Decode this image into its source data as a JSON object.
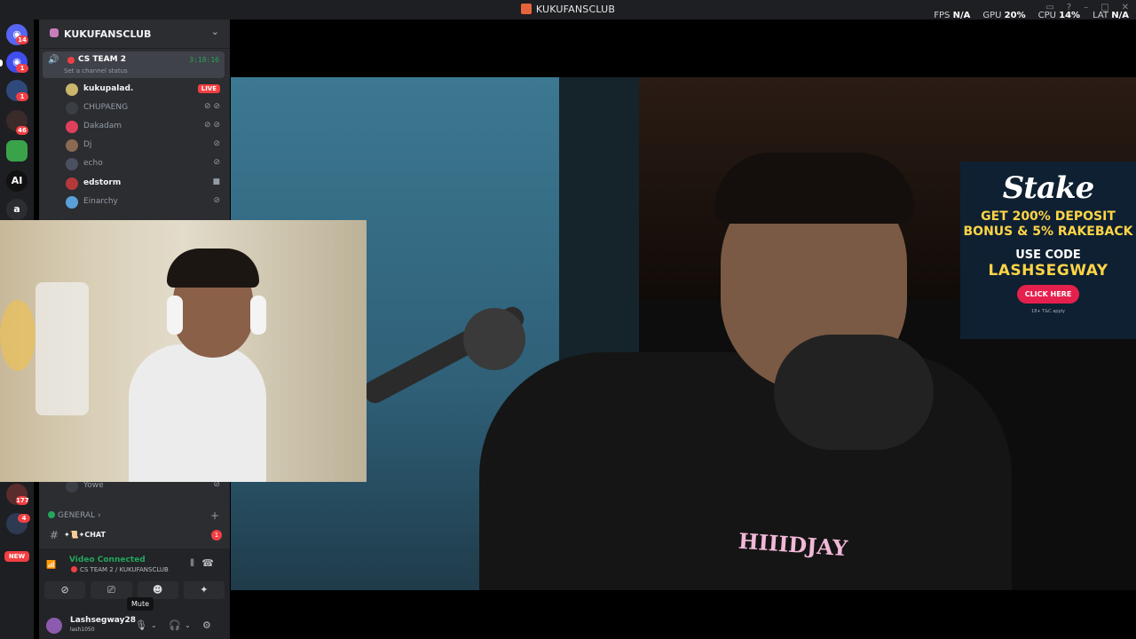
{
  "window": {
    "title": "KUKUFANSCLUB"
  },
  "stats": {
    "fps_label": "FPS",
    "fps_value": "N/A",
    "gpu_label": "GPU",
    "gpu_value": "20%",
    "cpu_label": "CPU",
    "cpu_value": "14%",
    "lat_label": "LAT",
    "lat_value": "N/A"
  },
  "guilds": {
    "badges": [
      "14",
      "1",
      "1",
      "46",
      "177",
      "4"
    ],
    "ai_label": "AI",
    "a_label": "a",
    "new_label": "NEW"
  },
  "server": {
    "name": "KUKUFANSCLUB"
  },
  "voice_channel": {
    "name": "CS TEAM 2",
    "timer": "3:18:16",
    "status_placeholder": "Set a channel status"
  },
  "members": [
    {
      "name": "kukupalad.",
      "live": "LIVE"
    },
    {
      "name": "CHUPAENG"
    },
    {
      "name": "Dakadam"
    },
    {
      "name": "Dj"
    },
    {
      "name": "echo"
    },
    {
      "name": "edstorm"
    },
    {
      "name": "Einarchy"
    },
    {
      "name": "Yowe"
    }
  ],
  "category": {
    "name": "GENERAL"
  },
  "text_channel": {
    "name": "✦📜✦CHAT",
    "unread": "1"
  },
  "connection": {
    "title": "Video Connected",
    "subtitle": "CS TEAM 2 / KUKUFANSCLUB"
  },
  "tooltip": {
    "text": "Mute"
  },
  "user": {
    "name": "Lashsegway28",
    "tag": "lash1050"
  },
  "ad": {
    "brand": "Stake",
    "promo": "GET 200% DEPOSIT BONUS & 5% RAKEBACK",
    "use_code": "USE CODE",
    "code": "LASHSEGWAY",
    "button": "CLICK HERE",
    "fine_print": "18+ T&C apply"
  },
  "shirt_text": "HIIIDJAY"
}
